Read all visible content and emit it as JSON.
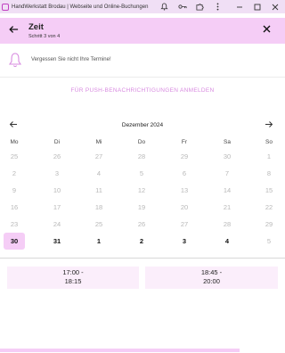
{
  "window": {
    "title": "HandWerkstatt Brodau | Webseite und Online-Buchungen",
    "icons": [
      "app-logo-icon",
      "bell-icon",
      "key-icon",
      "puzzle-icon",
      "more-vert-icon",
      "minimize-icon",
      "maximize-icon",
      "close-icon"
    ]
  },
  "header": {
    "title": "Zeit",
    "subtitle": "Schritt 3 von 4"
  },
  "reminder": {
    "text": "Vergessen Sie nicht Ihre Termine!"
  },
  "push": {
    "label": "FÜR PUSH-BENACHRICHTIGUNGEN ANMELDEN"
  },
  "calendar": {
    "month": "Dezember 2024",
    "weekdays": [
      "Mo",
      "Di",
      "Mi",
      "Do",
      "Fr",
      "Sa",
      "So"
    ],
    "weeks": [
      [
        "25",
        "26",
        "27",
        "28",
        "29",
        "30",
        "1"
      ],
      [
        "2",
        "3",
        "4",
        "5",
        "6",
        "7",
        "8"
      ],
      [
        "9",
        "10",
        "11",
        "12",
        "13",
        "14",
        "15"
      ],
      [
        "16",
        "17",
        "18",
        "19",
        "20",
        "21",
        "22"
      ],
      [
        "23",
        "24",
        "25",
        "26",
        "27",
        "28",
        "29"
      ],
      [
        "30",
        "31",
        "1",
        "2",
        "3",
        "4",
        "5"
      ]
    ],
    "selected": "30"
  },
  "slots": [
    {
      "line1": "17:00 -",
      "line2": "18:15"
    },
    {
      "line1": "18:45 -",
      "line2": "20:00"
    }
  ],
  "colors": {
    "accent": "#f5cdf6",
    "accent_text": "#d88be0",
    "slot_bg": "#fbeefb"
  }
}
